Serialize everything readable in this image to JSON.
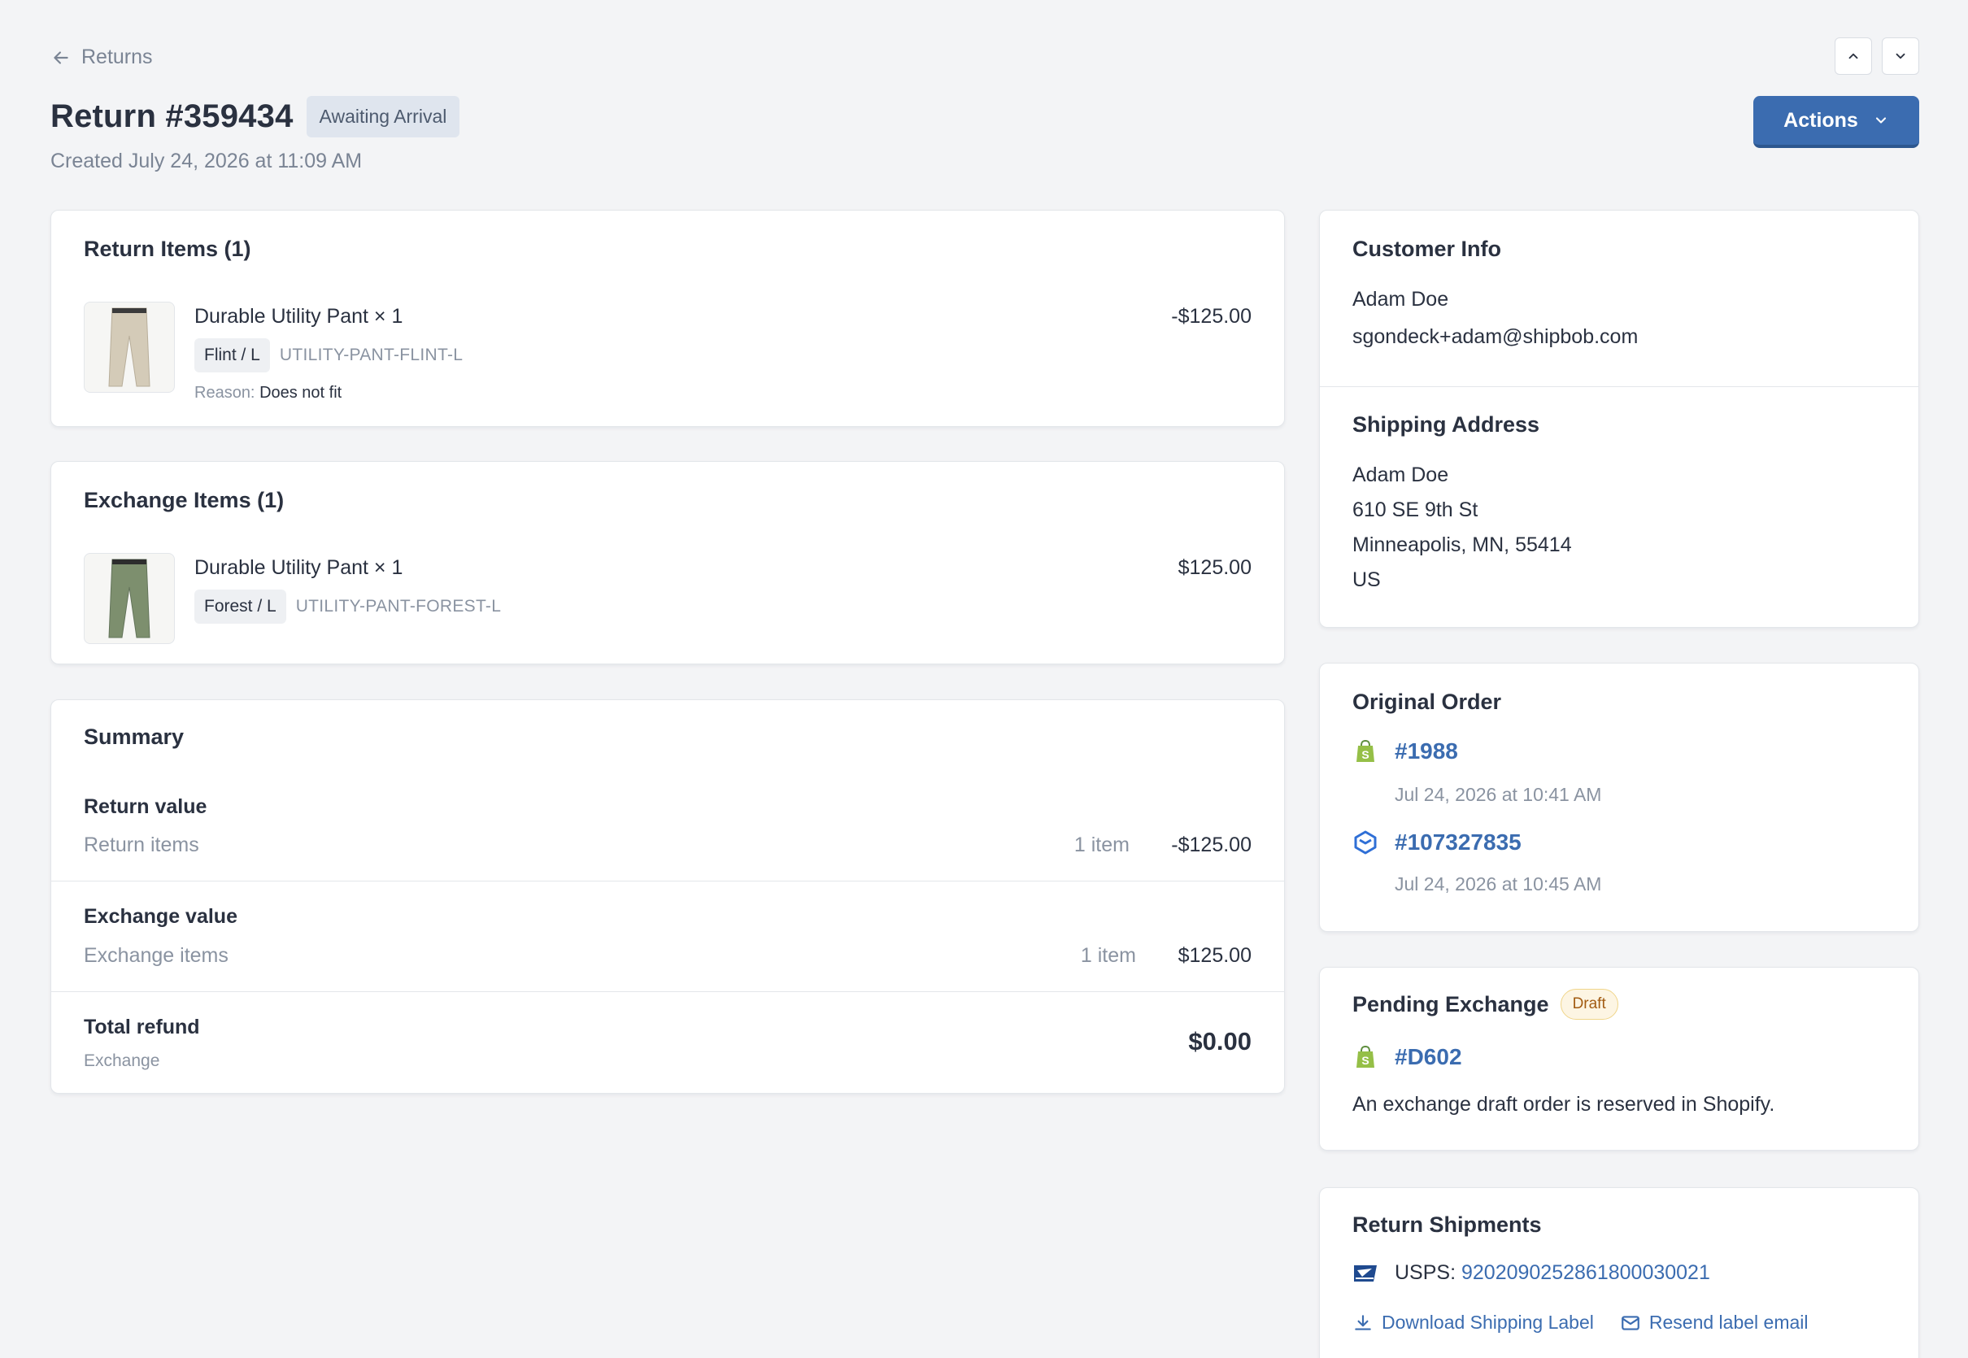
{
  "header": {
    "back_label": "Returns",
    "title": "Return #359434",
    "status": "Awaiting Arrival",
    "created": "Created July 24, 2026 at 11:09 AM",
    "actions_label": "Actions"
  },
  "return_items": {
    "title": "Return Items (1)",
    "items": [
      {
        "name": "Durable Utility Pant × 1",
        "variant": "Flint / L",
        "sku": "UTILITY-PANT-FLINT-L",
        "reason_label": "Reason:",
        "reason": "Does not fit",
        "price": "-$125.00",
        "thumb_color": "#d4cbb8"
      }
    ]
  },
  "exchange_items": {
    "title": "Exchange Items (1)",
    "items": [
      {
        "name": "Durable Utility Pant × 1",
        "variant": "Forest / L",
        "sku": "UTILITY-PANT-FOREST-L",
        "price": "$125.00",
        "thumb_color": "#7d8f6e"
      }
    ]
  },
  "summary": {
    "title": "Summary",
    "return_value": {
      "heading": "Return value",
      "label": "Return items",
      "qty": "1 item",
      "amount": "-$125.00"
    },
    "exchange_value": {
      "heading": "Exchange value",
      "label": "Exchange items",
      "qty": "1 item",
      "amount": "$125.00"
    },
    "total_refund": {
      "heading": "Total refund",
      "label": "Exchange",
      "amount": "$0.00"
    }
  },
  "customer_info": {
    "title": "Customer Info",
    "name": "Adam Doe",
    "email": "sgondeck+adam@shipbob.com"
  },
  "shipping_address": {
    "title": "Shipping Address",
    "lines": [
      "Adam Doe",
      "610 SE 9th St",
      "Minneapolis, MN, 55414",
      "US"
    ]
  },
  "original_order": {
    "title": "Original Order",
    "orders": [
      {
        "icon": "shopify-icon",
        "number": "#1988",
        "date": "Jul 24, 2026 at 10:41 AM"
      },
      {
        "icon": "shipbob-icon",
        "number": "#107327835",
        "date": "Jul 24, 2026 at 10:45 AM"
      }
    ]
  },
  "pending_exchange": {
    "title": "Pending Exchange",
    "badge": "Draft",
    "order_number": "#D602",
    "note": "An exchange draft order is reserved in Shopify."
  },
  "return_shipments": {
    "title": "Return Shipments",
    "carrier": "USPS:",
    "tracking": "9202090252861800030021",
    "download_label": "Download Shipping Label",
    "resend_label": "Resend label email"
  },
  "colors": {
    "accent": "#3b6cb0",
    "shopify_green": "#95bf47",
    "shipbob_blue": "#2f6fd6",
    "background": "#f3f4f6"
  }
}
